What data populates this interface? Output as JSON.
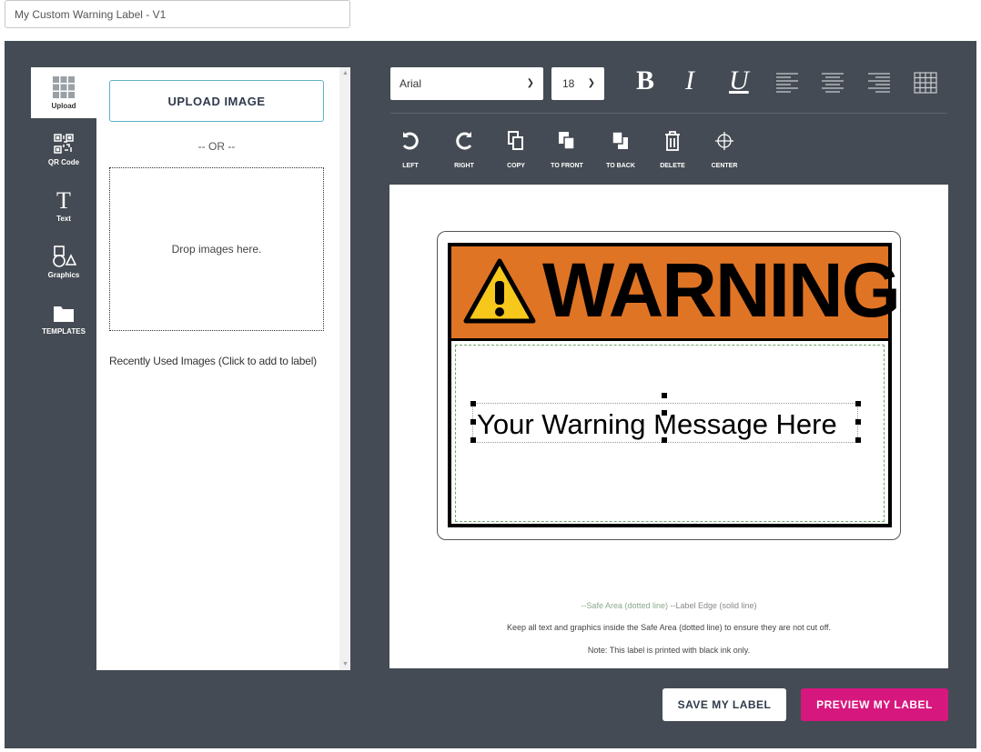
{
  "label_name": {
    "value": "My Custom Warning Label - V1"
  },
  "sidebar": {
    "items": [
      {
        "label": "Upload",
        "icon": "grid-icon"
      },
      {
        "label": "QR Code",
        "icon": "qr-code-icon"
      },
      {
        "label": "Text",
        "icon": "text-icon"
      },
      {
        "label": "Graphics",
        "icon": "shapes-icon"
      },
      {
        "label": "TEMPLATES",
        "icon": "folder-icon"
      }
    ]
  },
  "upload_panel": {
    "upload_button": "UPLOAD IMAGE",
    "or_text": "-- OR --",
    "drop_text": "Drop images here.",
    "recent_text": "Recently Used Images (Click to add to label)"
  },
  "toolbar": {
    "font": "Arial",
    "size": "18",
    "bold": "B",
    "italic": "I",
    "underline": "U",
    "actions": [
      {
        "label": "LEFT",
        "icon": "rotate-left-icon"
      },
      {
        "label": "RIGHT",
        "icon": "rotate-right-icon"
      },
      {
        "label": "COPY",
        "icon": "copy-icon"
      },
      {
        "label": "TO FRONT",
        "icon": "bring-front-icon"
      },
      {
        "label": "TO BACK",
        "icon": "send-back-icon"
      },
      {
        "label": "DELETE",
        "icon": "trash-icon"
      },
      {
        "label": "CENTER",
        "icon": "crosshair-icon"
      }
    ]
  },
  "canvas": {
    "header_word": "WARNING",
    "message": "Your Warning Message Here",
    "colors": {
      "header": "#e07425",
      "triangle": "#f6c81c"
    },
    "notes": {
      "safe_area": "--Safe Area (dotted line)",
      "label_edge": " --Label Edge (solid line)",
      "keep_inside": "Keep all text and graphics inside the Safe Area (dotted line) to ensure they are not cut off.",
      "ink": "Note: This label is printed with black ink only."
    }
  },
  "buttons": {
    "save": "SAVE MY LABEL",
    "preview": "PREVIEW MY LABEL",
    "preview_color": "#d6177e"
  }
}
